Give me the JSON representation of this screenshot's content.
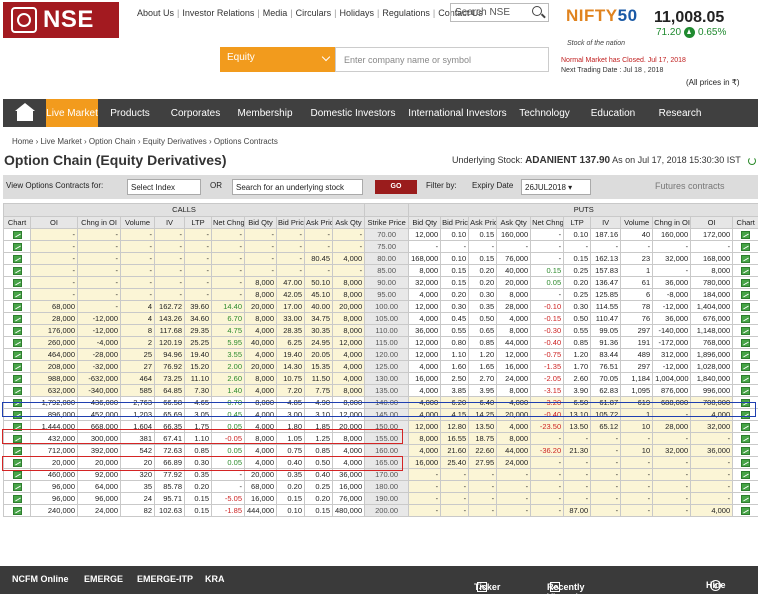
{
  "brand": {
    "logo_text": "NSE"
  },
  "header_links": [
    "About Us",
    "Investor Relations",
    "Media",
    "Circulars",
    "Holidays",
    "Regulations",
    "Contact Us"
  ],
  "search": {
    "placeholder": "Search NSE"
  },
  "nifty": {
    "name_a": "NIFTY",
    "name_b": "50",
    "tagline": "Stock of the nation",
    "value": "11,008.05",
    "change": "71.20",
    "change_pct": "0.65%",
    "up_color": "#1f8a2f",
    "market_status": "Normal Market has Closed. Jul 17, 2018",
    "next_trading": "Next Trading Date : Jul 18 , 2018",
    "all_prices": "(All prices in ₹)"
  },
  "equity_select": {
    "value": "Equity"
  },
  "company_input": {
    "placeholder": "Enter company name or symbol"
  },
  "nav": {
    "items": [
      "Live Market",
      "Products",
      "Corporates",
      "Membership",
      "Domestic Investors",
      "International Investors",
      "Technology",
      "Education",
      "Research"
    ],
    "active": "Live Market",
    "active_color": "#f29b1d"
  },
  "breadcrumb": [
    "Home",
    "Live Market",
    "Option Chain",
    "Equity Derivatives",
    "Options Contracts"
  ],
  "page_title": "Option Chain (Equity Derivatives)",
  "underlying": {
    "label": "Underlying Stock:",
    "symbol": "ADANIENT 137.90",
    "asof": "As on Jul 17, 2018 15:30:30 IST"
  },
  "filter": {
    "view_label": "View Options Contracts for:",
    "index_select": "Select Index",
    "or_label": "OR",
    "search_value": "Search for an underlying stock",
    "go_label": "GO",
    "filter_label": "Filter by:",
    "expiry_label": "Expiry Date",
    "expiry_value": "26JUL2018",
    "futures_label": "Futures contracts"
  },
  "table": {
    "calls_label": "CALLS",
    "puts_label": "PUTS",
    "headers_calls": [
      "Chart",
      "OI",
      "Chng in OI",
      "Volume",
      "IV",
      "LTP",
      "Net Chng",
      "Bid Qty",
      "Bid Price",
      "Ask Price",
      "Ask Qty"
    ],
    "header_strike": "Strike Price",
    "headers_puts": [
      "Bid Qty",
      "Bid Price",
      "Ask Price",
      "Ask Qty",
      "Net Chng",
      "LTP",
      "IV",
      "Volume",
      "Chng in OI",
      "OI",
      "Chart"
    ],
    "itm_color": "#fbf5d6",
    "rows": [
      {
        "c": [
          "-",
          "-",
          "-",
          "-",
          "-",
          "-",
          "-",
          "-",
          "-",
          "-"
        ],
        "s": "70.00",
        "p": [
          "12,000",
          "0.10",
          "0.15",
          "160,000",
          "-",
          "0.10",
          "187.16",
          "40",
          "160,000",
          "172,000"
        ]
      },
      {
        "c": [
          "-",
          "-",
          "-",
          "-",
          "-",
          "-",
          "-",
          "-",
          "-",
          "-"
        ],
        "s": "75.00",
        "p": [
          "-",
          "-",
          "-",
          "-",
          "-",
          "-",
          "-",
          "-",
          "-",
          "-"
        ]
      },
      {
        "c": [
          "-",
          "-",
          "-",
          "-",
          "-",
          "-",
          "-",
          "-",
          "80.45",
          "4,000"
        ],
        "s": "80.00",
        "p": [
          "168,000",
          "0.10",
          "0.15",
          "76,000",
          "-",
          "0.15",
          "162.13",
          "23",
          "32,000",
          "168,000"
        ]
      },
      {
        "c": [
          "-",
          "-",
          "-",
          "-",
          "-",
          "-",
          "-",
          "-",
          "-",
          "-"
        ],
        "s": "85.00",
        "p": [
          "8,000",
          "0.15",
          "0.20",
          "40,000",
          "0.15",
          "0.25",
          "157.83",
          "1",
          "-",
          "8,000"
        ]
      },
      {
        "c": [
          "-",
          "-",
          "-",
          "-",
          "-",
          "-",
          "8,000",
          "47.00",
          "50.10",
          "8,000"
        ],
        "s": "90.00",
        "p": [
          "32,000",
          "0.15",
          "0.20",
          "20,000",
          "0.05",
          "0.20",
          "136.47",
          "61",
          "36,000",
          "780,000"
        ]
      },
      {
        "c": [
          "-",
          "-",
          "-",
          "-",
          "-",
          "-",
          "8,000",
          "42.05",
          "45.10",
          "8,000"
        ],
        "s": "95.00",
        "p": [
          "4,000",
          "0.20",
          "0.30",
          "8,000",
          "-",
          "0.25",
          "125.85",
          "6",
          "-8,000",
          "184,000"
        ]
      },
      {
        "c": [
          "68,000",
          "-",
          "4",
          "162.72",
          "39.60",
          "14.40",
          "20,000",
          "17.00",
          "40.00",
          "20,000"
        ],
        "s": "100.00",
        "p": [
          "12,000",
          "0.30",
          "0.35",
          "28,000",
          "-0.10",
          "0.30",
          "114.55",
          "78",
          "-12,000",
          "1,404,000"
        ]
      },
      {
        "c": [
          "28,000",
          "-12,000",
          "4",
          "143.26",
          "34.60",
          "6.70",
          "8,000",
          "33.00",
          "34.75",
          "8,000"
        ],
        "s": "105.00",
        "p": [
          "4,000",
          "0.45",
          "0.50",
          "4,000",
          "-0.15",
          "0.50",
          "110.47",
          "76",
          "36,000",
          "676,000"
        ]
      },
      {
        "c": [
          "176,000",
          "-12,000",
          "8",
          "117.68",
          "29.35",
          "4.75",
          "4,000",
          "28.35",
          "30.35",
          "8,000"
        ],
        "s": "110.00",
        "p": [
          "36,000",
          "0.55",
          "0.65",
          "8,000",
          "-0.30",
          "0.55",
          "99.05",
          "297",
          "-140,000",
          "1,148,000"
        ]
      },
      {
        "c": [
          "260,000",
          "-4,000",
          "2",
          "120.19",
          "25.25",
          "5.95",
          "40,000",
          "6.25",
          "24.95",
          "12,000"
        ],
        "s": "115.00",
        "p": [
          "12,000",
          "0.80",
          "0.85",
          "44,000",
          "-0.40",
          "0.85",
          "91.36",
          "191",
          "-172,000",
          "768,000"
        ]
      },
      {
        "c": [
          "464,000",
          "-28,000",
          "25",
          "94.96",
          "19.40",
          "3.55",
          "4,000",
          "19.40",
          "20.05",
          "4,000"
        ],
        "s": "120.00",
        "p": [
          "12,000",
          "1.10",
          "1.20",
          "12,000",
          "-0.75",
          "1.20",
          "83.44",
          "489",
          "312,000",
          "1,896,000"
        ]
      },
      {
        "c": [
          "208,000",
          "-32,000",
          "27",
          "76.92",
          "15.20",
          "2.00",
          "20,000",
          "14.30",
          "15.35",
          "4,000"
        ],
        "s": "125.00",
        "p": [
          "4,000",
          "1.60",
          "1.65",
          "16,000",
          "-1.35",
          "1.70",
          "76.51",
          "297",
          "-12,000",
          "1,028,000"
        ]
      },
      {
        "c": [
          "988,000",
          "-632,000",
          "464",
          "73.25",
          "11.10",
          "2.60",
          "8,000",
          "10.75",
          "11.50",
          "4,000"
        ],
        "s": "130.00",
        "p": [
          "16,000",
          "2.50",
          "2.70",
          "24,000",
          "-2.05",
          "2.60",
          "70.05",
          "1,184",
          "1,004,000",
          "1,840,000"
        ]
      },
      {
        "c": [
          "632,000",
          "-340,000",
          "585",
          "64.85",
          "7.30",
          "1.40",
          "4,000",
          "7.20",
          "7.75",
          "8,000"
        ],
        "s": "135.00",
        "p": [
          "4,000",
          "3.85",
          "3.95",
          "8,000",
          "-3.15",
          "3.90",
          "62.83",
          "1,095",
          "876,000",
          "996,000"
        ]
      },
      {
        "c": [
          "1,792,000",
          "436,000",
          "2,763",
          "66.58",
          "4.65",
          "0.70",
          "8,000",
          "4.85",
          "4.90",
          "8,000"
        ],
        "s": "140.00",
        "p": [
          "4,000",
          "6.20",
          "6.40",
          "4,000",
          "-3.20",
          "6.50",
          "61.87",
          "619",
          "688,000",
          "708,000"
        ]
      },
      {
        "c": [
          "896,000",
          "452,000",
          "1,203",
          "65.69",
          "3.05",
          "0.45",
          "4,000",
          "3.00",
          "3.10",
          "12,000"
        ],
        "s": "145.00",
        "p": [
          "4,000",
          "4.15",
          "14.25",
          "20,000",
          "-0.40",
          "13.10",
          "105.72",
          "1",
          "-",
          "4,000"
        ]
      },
      {
        "c": [
          "1,444,000",
          "668,000",
          "1,604",
          "66.35",
          "1.75",
          "0.05",
          "4,000",
          "1.80",
          "1.85",
          "20,000"
        ],
        "s": "150.00",
        "p": [
          "12,000",
          "12.80",
          "13.50",
          "4,000",
          "-23.50",
          "13.50",
          "65.12",
          "10",
          "28,000",
          "32,000"
        ]
      },
      {
        "c": [
          "432,000",
          "300,000",
          "381",
          "67.41",
          "1.10",
          "-0.05",
          "8,000",
          "1.05",
          "1.25",
          "8,000"
        ],
        "s": "155.00",
        "p": [
          "8,000",
          "16.55",
          "18.75",
          "8,000",
          "-",
          "-",
          "-",
          "-",
          "-",
          "-"
        ]
      },
      {
        "c": [
          "712,000",
          "392,000",
          "542",
          "72.63",
          "0.85",
          "0.05",
          "4,000",
          "0.75",
          "0.85",
          "4,000"
        ],
        "s": "160.00",
        "p": [
          "4,000",
          "21.60",
          "22.60",
          "44,000",
          "-36.20",
          "21.30",
          "-",
          "10",
          "32,000",
          "36,000"
        ]
      },
      {
        "c": [
          "20,000",
          "20,000",
          "20",
          "66.89",
          "0.30",
          "0.05",
          "4,000",
          "0.40",
          "0.50",
          "4,000"
        ],
        "s": "165.00",
        "p": [
          "16,000",
          "25.40",
          "27.95",
          "24,000",
          "-",
          "-",
          "-",
          "-",
          "-",
          "-"
        ]
      },
      {
        "c": [
          "460,000",
          "92,000",
          "320",
          "77.92",
          "0.35",
          "-",
          "20,000",
          "0.35",
          "0.40",
          "36,000"
        ],
        "s": "170.00",
        "p": [
          "-",
          "-",
          "-",
          "-",
          "-",
          "-",
          "-",
          "-",
          "-",
          "-"
        ]
      },
      {
        "c": [
          "96,000",
          "64,000",
          "35",
          "85.78",
          "0.20",
          "-",
          "68,000",
          "0.20",
          "0.25",
          "16,000"
        ],
        "s": "180.00",
        "p": [
          "-",
          "-",
          "-",
          "-",
          "-",
          "-",
          "-",
          "-",
          "-",
          "-"
        ]
      },
      {
        "c": [
          "96,000",
          "96,000",
          "24",
          "95.71",
          "0.15",
          "-5.05",
          "16,000",
          "0.15",
          "0.20",
          "76,000"
        ],
        "s": "190.00",
        "p": [
          "-",
          "-",
          "-",
          "-",
          "-",
          "-",
          "-",
          "-",
          "-",
          "-"
        ]
      },
      {
        "c": [
          "240,000",
          "24,000",
          "82",
          "102.63",
          "0.15",
          "-1.85",
          "444,000",
          "0.10",
          "0.15",
          "480,000"
        ],
        "s": "200.00",
        "p": [
          "-",
          "-",
          "-",
          "-",
          "-",
          "87.00",
          "-",
          "-",
          "-",
          "4,000"
        ]
      }
    ]
  },
  "highlights": {
    "blue": "#1f3fb0",
    "red": "#d42424"
  },
  "footer": {
    "links": [
      "NCFM Online",
      "EMERGE",
      "EMERGE-ITP",
      "KRA"
    ],
    "ticker": "Ticker",
    "recent": "Recently Viewed Quotes",
    "hide": "Hide"
  }
}
